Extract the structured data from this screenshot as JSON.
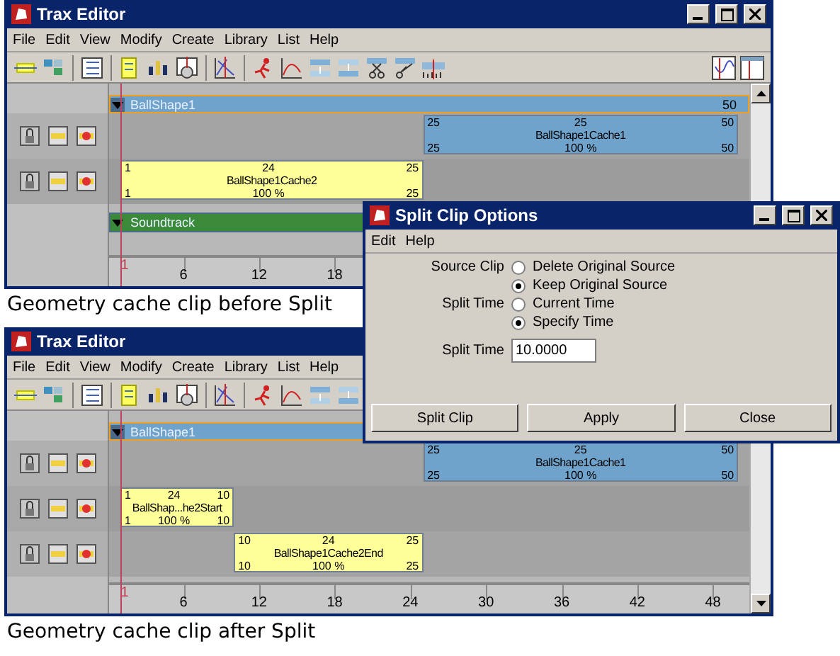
{
  "windows": [
    {
      "title": "Trax Editor",
      "menu": [
        "File",
        "Edit",
        "View",
        "Modify",
        "Create",
        "Library",
        "List",
        "Help"
      ],
      "characters": [
        {
          "name": "BallShape1",
          "end": "50",
          "expanded": true,
          "selected": true,
          "tracks": [
            {
              "clips": [
                {
                  "start": "25",
                  "marker": "25",
                  "end": "50",
                  "name": "BallShape1Cache1",
                  "source_start": "25",
                  "scale": "100 %",
                  "source_end": "50",
                  "color": "#6fa3cb"
                }
              ]
            },
            {
              "clips": [
                {
                  "start": "1",
                  "marker": "24",
                  "end": "25",
                  "name": "BallShape1Cache2",
                  "source_start": "1",
                  "scale": "100 %",
                  "source_end": "25",
                  "color": "#ffff99"
                }
              ]
            }
          ]
        }
      ],
      "soundtrack": {
        "name": "Soundtrack",
        "expanded": true
      },
      "ruler": [
        "1",
        "6",
        "12",
        "18"
      ],
      "caption": "Geometry cache clip before Split"
    },
    {
      "title": "Trax Editor",
      "menu": [
        "File",
        "Edit",
        "View",
        "Modify",
        "Create",
        "Library",
        "List",
        "Help"
      ],
      "characters": [
        {
          "name": "BallShape1",
          "expanded": true,
          "selected": true,
          "tracks": [
            {
              "clips": [
                {
                  "start": "25",
                  "marker": "25",
                  "end": "50",
                  "name": "BallShape1Cache1",
                  "source_start": "25",
                  "scale": "100 %",
                  "source_end": "50",
                  "color": "#6fa3cb"
                }
              ]
            },
            {
              "clips": [
                {
                  "start": "1",
                  "marker": "24",
                  "end": "10",
                  "name": "BallShap...he2Start",
                  "source_start": "1",
                  "scale": "100 %",
                  "source_end": "10",
                  "color": "#ffff99"
                }
              ]
            },
            {
              "clips": [
                {
                  "start": "10",
                  "marker": "24",
                  "end": "25",
                  "name": "BallShape1Cache2End",
                  "source_start": "10",
                  "scale": "100 %",
                  "source_end": "25",
                  "color": "#ffff99"
                }
              ]
            }
          ]
        }
      ],
      "ruler": [
        "1",
        "6",
        "12",
        "18",
        "24",
        "30",
        "36",
        "42",
        "48"
      ],
      "caption": "Geometry cache clip after Split"
    }
  ],
  "dialog": {
    "title": "Split Clip Options",
    "menu": [
      "Edit",
      "Help"
    ],
    "options": [
      {
        "label": "Source Clip",
        "choices": [
          {
            "label": "Delete Original Source",
            "selected": false
          },
          {
            "label": "Keep Original Source",
            "selected": true
          }
        ]
      },
      {
        "label": "Split Time",
        "choices": [
          {
            "label": "Current Time",
            "selected": false
          },
          {
            "label": "Specify Time",
            "selected": true
          }
        ]
      }
    ],
    "field": {
      "label": "Split Time",
      "value": "10.0000"
    },
    "buttons": [
      "Split Clip",
      "Apply",
      "Close"
    ]
  }
}
